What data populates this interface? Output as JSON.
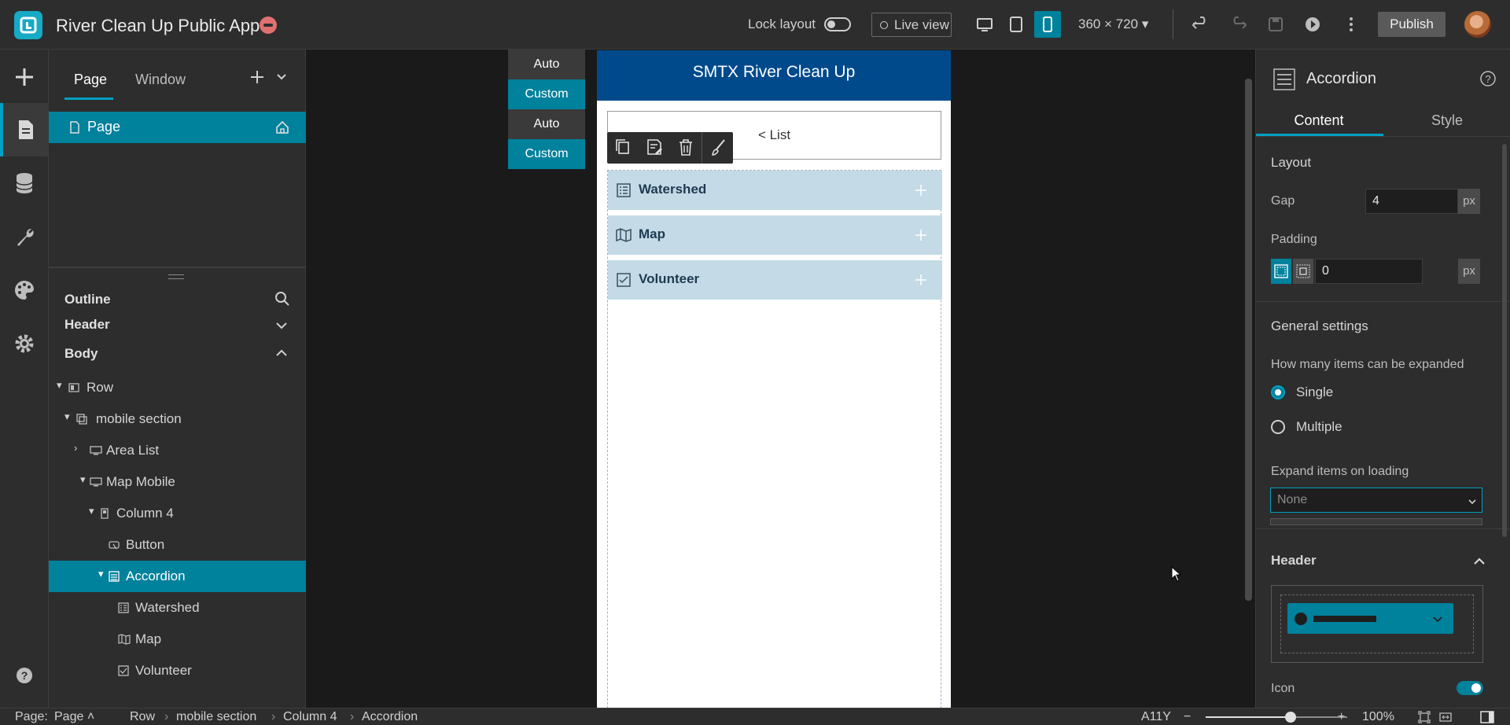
{
  "app": {
    "title": "River Clean Up Public App",
    "lock_layout_label": "Lock layout",
    "live_view_label": "Live view",
    "device_size": "360 × 720",
    "publish_label": "Publish"
  },
  "left_panel": {
    "tabs": [
      "Page",
      "Window"
    ],
    "page_item": "Page",
    "outline_title": "Outline",
    "header_section": "Header",
    "body_section": "Body",
    "tree": [
      {
        "label": "Row"
      },
      {
        "label": "mobile section"
      },
      {
        "label": "Area List"
      },
      {
        "label": "Map Mobile"
      },
      {
        "label": "Column 4"
      },
      {
        "label": "Button"
      },
      {
        "label": "Accordion",
        "selected": true
      },
      {
        "label": "Watershed"
      },
      {
        "label": "Map"
      },
      {
        "label": "Volunteer"
      }
    ]
  },
  "canvas": {
    "size_buttons": [
      "Auto",
      "Custom",
      "Auto",
      "Custom"
    ],
    "app_header": "SMTX River Clean Up",
    "list_button": "< List",
    "accordion_items": [
      "Watershed",
      "Map",
      "Volunteer"
    ]
  },
  "right_panel": {
    "widget_title": "Accordion",
    "tabs": [
      "Content",
      "Style"
    ],
    "layout_label": "Layout",
    "gap_label": "Gap",
    "gap_value": "4",
    "unit": "px",
    "padding_label": "Padding",
    "padding_value": "0",
    "general_settings_label": "General settings",
    "expand_question": "How many items can be expanded",
    "option_single": "Single",
    "option_multiple": "Multiple",
    "selected_option": "Single",
    "expand_loading_label": "Expand items on loading",
    "expand_loading_value": "None",
    "header_label": "Header",
    "icon_label": "Icon",
    "icon_enabled": true
  },
  "status_bar": {
    "page_label": "Page:",
    "page_value": "Page",
    "breadcrumb": [
      "Row",
      "mobile section",
      "Column 4",
      "Accordion"
    ],
    "a11y": "A11Y",
    "zoom": "100%",
    "zoom_level": 0.6
  },
  "colors": {
    "accent": "#00819c",
    "app_header_bg": "#004a8c",
    "accordion_item_bg": "#c4dae6"
  }
}
